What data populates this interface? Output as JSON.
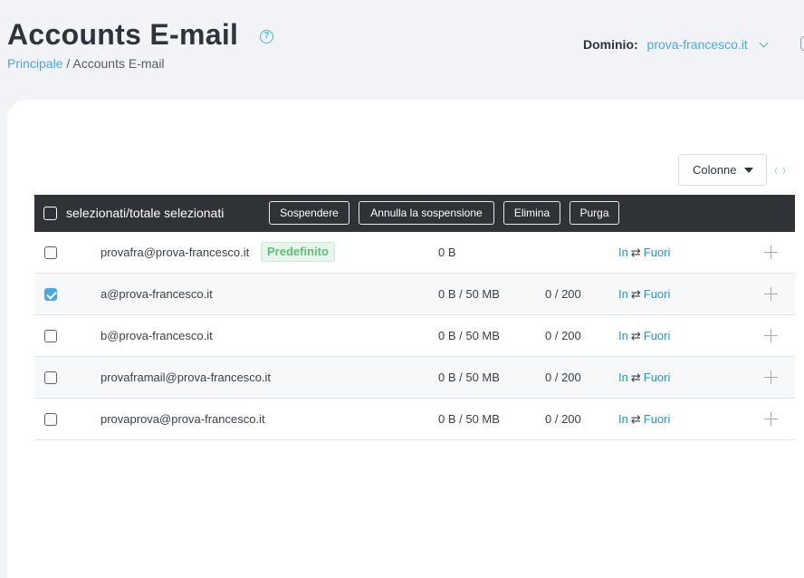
{
  "header": {
    "title": "Accounts E-mail",
    "help_icon": "question-circle-icon",
    "breadcrumb": {
      "home": "Principale",
      "separator": "/",
      "current": "Accounts E-mail"
    },
    "domain_label": "Dominio:",
    "domain_value": "prova-francesco.it"
  },
  "table_controls": {
    "columns_label": "Colonne",
    "refresh_icon": "refresh-icon"
  },
  "toolbar": {
    "selection_label": "selezionati/totale selezionati",
    "buttons": [
      "Sospendere",
      "Annulla la sospensione",
      "Elimina",
      "Purga"
    ]
  },
  "accounts": [
    {
      "email": "provafra@prova-francesco.it",
      "badge": "Predefinito",
      "usage": "0 B",
      "count": "",
      "in": "In",
      "swap": "⇄",
      "out": "Fuori",
      "checked": false
    },
    {
      "email": "a@prova-francesco.it",
      "badge": "",
      "usage": "0 B / 50 MB",
      "count": "0 / 200",
      "in": "In",
      "swap": "⇄",
      "out": "Fuori",
      "checked": true
    },
    {
      "email": "b@prova-francesco.it",
      "badge": "",
      "usage": "0 B / 50 MB",
      "count": "0 / 200",
      "in": "In",
      "swap": "⇄",
      "out": "Fuori",
      "checked": false
    },
    {
      "email": "provaframail@prova-francesco.it",
      "badge": "",
      "usage": "0 B / 50 MB",
      "count": "0 / 200",
      "in": "In",
      "swap": "⇄",
      "out": "Fuori",
      "checked": false
    },
    {
      "email": "provaprova@prova-francesco.it",
      "badge": "",
      "usage": "0 B / 50 MB",
      "count": "0 / 200",
      "in": "In",
      "swap": "⇄",
      "out": "Fuori",
      "checked": false
    }
  ],
  "colors": {
    "accent": "#4aa8df",
    "link": "#2f8fd1",
    "toolbar_bg": "#2f3338",
    "badge_text": "#5cbf7a"
  }
}
